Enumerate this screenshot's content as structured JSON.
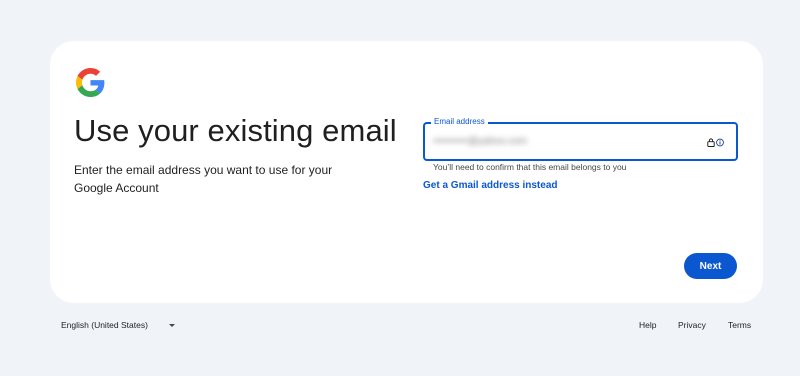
{
  "header": {
    "title": "Use your existing email",
    "subtitle": "Enter the email address you want to use for your Google Account"
  },
  "email_field": {
    "label": "Email address",
    "value": "••••••••••@yahoo.com",
    "helper": "You’ll need to confirm that this email belongs to you",
    "icons": [
      "lock-icon",
      "info-icon"
    ]
  },
  "links": {
    "gmail_instead": "Get a Gmail address instead"
  },
  "actions": {
    "next_label": "Next"
  },
  "footer": {
    "language": "English (United States)",
    "help": "Help",
    "privacy": "Privacy",
    "terms": "Terms"
  },
  "colors": {
    "background": "#f0f4f9",
    "card": "#ffffff",
    "accent": "#0b57d0",
    "google_blue": "#4285f4",
    "google_red": "#ea4335",
    "google_yellow": "#fbbc05",
    "google_green": "#34a853"
  }
}
